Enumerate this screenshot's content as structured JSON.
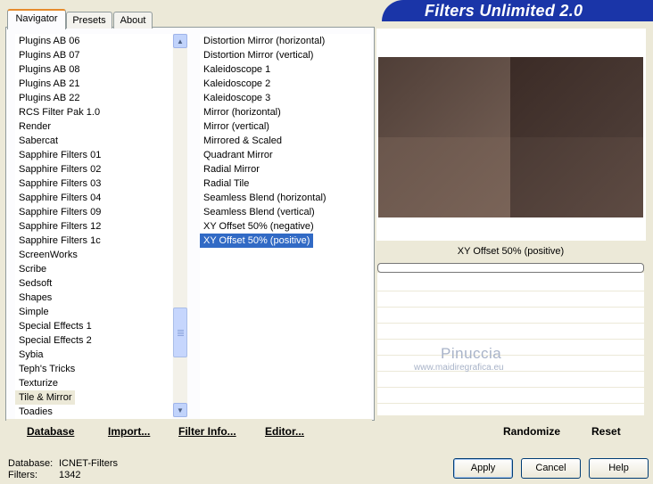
{
  "tabs": [
    "Navigator",
    "Presets",
    "About"
  ],
  "title": "Filters Unlimited 2.0",
  "categories": [
    "Plugins AB 06",
    "Plugins AB 07",
    "Plugins AB 08",
    "Plugins AB 21",
    "Plugins AB 22",
    "RCS Filter Pak 1.0",
    "Render",
    "Sabercat",
    "Sapphire Filters 01",
    "Sapphire Filters 02",
    "Sapphire Filters 03",
    "Sapphire Filters 04",
    "Sapphire Filters 09",
    "Sapphire Filters 12",
    "Sapphire Filters 1c",
    "ScreenWorks",
    "Scribe",
    "Sedsoft",
    "Shapes",
    "Simple",
    "Special Effects 1",
    "Special Effects 2",
    "Sybia",
    "Teph's Tricks",
    "Texturize",
    "Tile & Mirror",
    "Toadies"
  ],
  "selected_category": "Tile & Mirror",
  "filters": [
    "Distortion Mirror (horizontal)",
    "Distortion Mirror (vertical)",
    "Kaleidoscope 1",
    "Kaleidoscope 2",
    "Kaleidoscope 3",
    "Mirror (horizontal)",
    "Mirror (vertical)",
    "Mirrored & Scaled",
    "Quadrant Mirror",
    "Radial Mirror",
    "Radial Tile",
    "Seamless Blend (horizontal)",
    "Seamless Blend (vertical)",
    "XY Offset 50% (negative)",
    "XY Offset 50% (positive)"
  ],
  "selected_filter": "XY Offset 50% (positive)",
  "preview_label": "XY Offset 50% (positive)",
  "progress": 0,
  "watermark": {
    "line1": "Pinuccia",
    "line2": "www.maidiregrafica.eu"
  },
  "links": {
    "database": "Database",
    "import": "Import...",
    "filter_info": "Filter Info...",
    "editor": "Editor...",
    "randomize": "Randomize",
    "reset": "Reset"
  },
  "status": {
    "database_label": "Database:",
    "database_value": "ICNET-Filters",
    "filters_label": "Filters:",
    "filters_value": "1342"
  },
  "buttons": {
    "apply": "Apply",
    "cancel": "Cancel",
    "help": "Help"
  },
  "colors": {
    "banner": "#1a35a8",
    "selection": "#316ac5",
    "tile_light": "#6e5a50",
    "tile_dark": "#3f2f2a"
  },
  "icons": {
    "scroll_up": "chevron-up-icon",
    "scroll_down": "chevron-down-icon"
  }
}
